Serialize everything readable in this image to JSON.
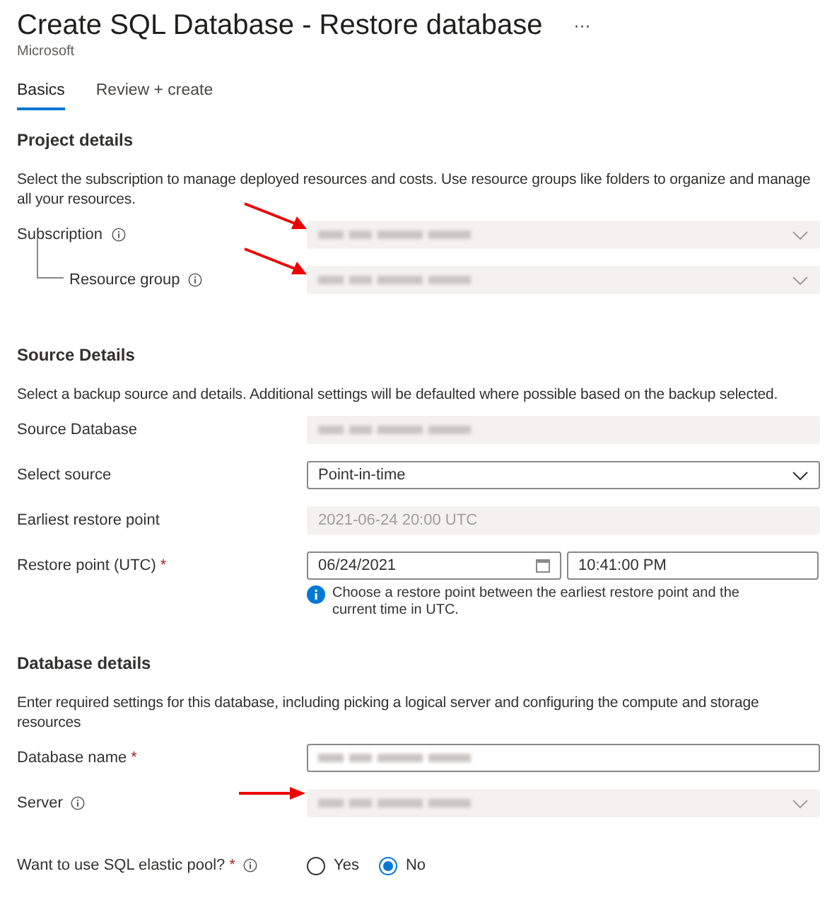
{
  "header": {
    "title": "Create SQL Database - Restore database",
    "more": "···",
    "publisher": "Microsoft"
  },
  "tabs": [
    {
      "label": "Basics",
      "selected": true
    },
    {
      "label": "Review + create",
      "selected": false
    }
  ],
  "sections": [
    {
      "title": "Project details",
      "description": "Select the subscription to manage deployed resources and costs. Use resource groups like folders to organize and manage all your resources.",
      "fields": [
        {
          "kind": "dropdown",
          "label": "Subscription",
          "info": true,
          "child": false,
          "disabled": true,
          "redacted": true,
          "arrow": {
            "kind": "diagonal"
          }
        },
        {
          "kind": "dropdown",
          "label": "Resource group",
          "info": true,
          "child": true,
          "disabled": true,
          "redacted": true,
          "arrow": {
            "kind": "diagonal"
          }
        }
      ]
    },
    {
      "title": "Source Details",
      "description": "Select a backup source and details. Additional settings will be defaulted where possible based on the backup selected.",
      "fields": [
        {
          "kind": "text",
          "label": "Source Database",
          "info": false,
          "child": false,
          "disabled": true,
          "redacted": true
        },
        {
          "kind": "dropdown",
          "label": "Select source",
          "info": false,
          "child": false,
          "disabled": false,
          "value": "Point-in-time"
        },
        {
          "kind": "text",
          "label": "Earliest restore point",
          "info": false,
          "child": false,
          "disabled": true,
          "value": "2021-06-24 20:00 UTC"
        },
        {
          "kind": "datetime",
          "label": "Restore point (UTC)",
          "required_mark": "*",
          "info": false,
          "child": false,
          "disabled": false,
          "date": "06/24/2021",
          "time": "10:41:00 PM",
          "hint": "Choose a restore point between the earliest restore point and the current time in UTC."
        }
      ]
    },
    {
      "title": "Database details",
      "description": "Enter required settings for this database, including picking a logical server and configuring the compute and storage resources",
      "fields": [
        {
          "kind": "text",
          "label": "Database name",
          "required_mark": "*",
          "info": false,
          "child": false,
          "disabled": false,
          "redacted": true
        },
        {
          "kind": "dropdown",
          "label": "Server",
          "info": true,
          "child": false,
          "disabled": true,
          "redacted": true,
          "arrow": {
            "kind": "horizontal"
          }
        },
        {
          "kind": "radio",
          "label": "Want to use SQL elastic pool?",
          "required_mark": "*",
          "info": true,
          "child": false,
          "options": [
            {
              "label": "Yes",
              "selected": false
            },
            {
              "label": "No",
              "selected": true
            }
          ]
        }
      ]
    }
  ]
}
